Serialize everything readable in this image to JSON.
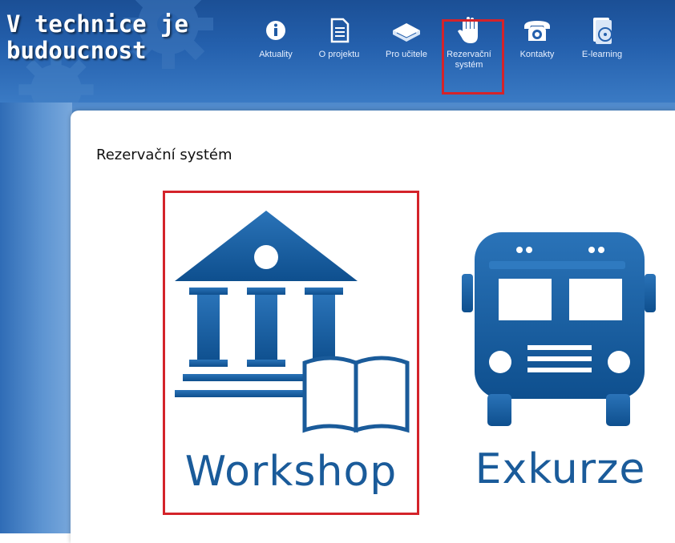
{
  "site": {
    "title_line1": "V technice je",
    "title_line2": "budoucnost"
  },
  "nav": {
    "items": [
      {
        "label_line1": "Aktuality",
        "label_line2": "",
        "icon": "info-icon"
      },
      {
        "label_line1": "O projektu",
        "label_line2": "",
        "icon": "document-icon"
      },
      {
        "label_line1": "Pro učitele",
        "label_line2": "",
        "icon": "book-icon"
      },
      {
        "label_line1": "Rezervační",
        "label_line2": "systém",
        "icon": "hand-icon"
      },
      {
        "label_line1": "Kontakty",
        "label_line2": "",
        "icon": "telephone-icon"
      },
      {
        "label_line1": "E-learning",
        "label_line2": "",
        "icon": "disc-box-icon"
      }
    ],
    "active_index": 3
  },
  "page": {
    "title": "Rezervační systém"
  },
  "cards": [
    {
      "label": "Workshop",
      "icon": "museum-book-icon",
      "highlighted": true
    },
    {
      "label": "Exkurze",
      "icon": "bus-icon",
      "highlighted": false
    }
  ],
  "colors": {
    "header": "#2460ad",
    "icon_blue": "#1a5b9a",
    "highlight": "#d4232a"
  }
}
